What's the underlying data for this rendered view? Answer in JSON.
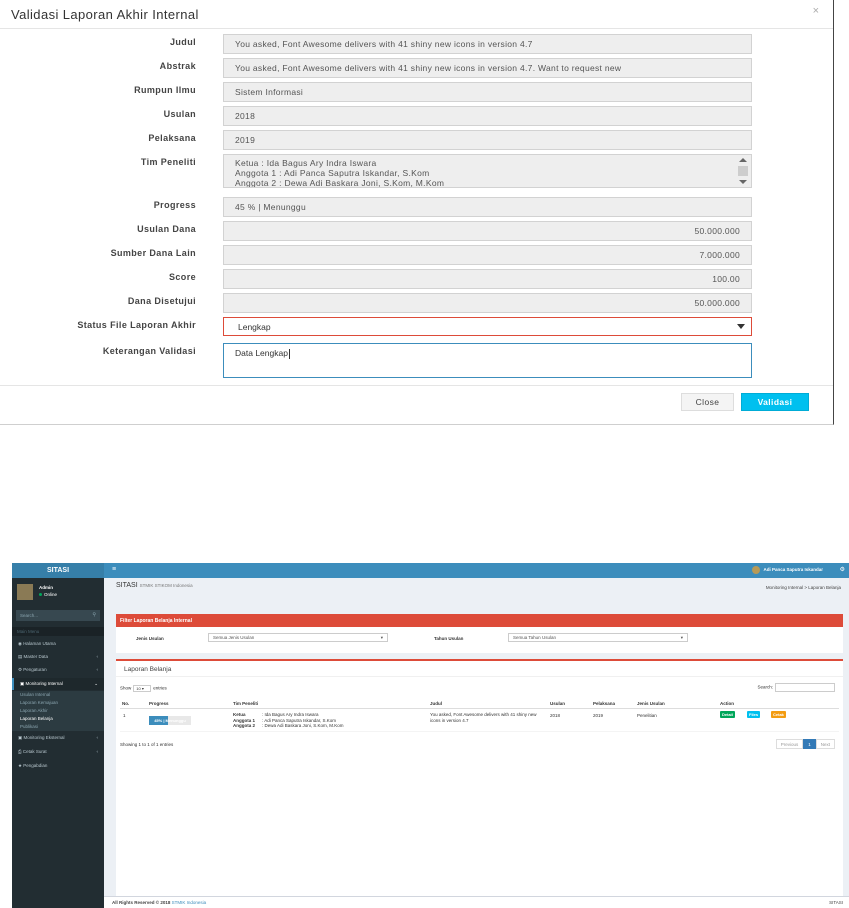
{
  "modal": {
    "title": "Validasi Laporan Akhir Internal",
    "close_glyph": "×",
    "fields": {
      "judul": {
        "label": "Judul",
        "value": "You asked, Font Awesome delivers with 41 shiny new icons in version 4.7"
      },
      "abstrak": {
        "label": "Abstrak",
        "value": "You asked, Font Awesome delivers with 41 shiny new icons in version 4.7. Want to request new"
      },
      "rumpun": {
        "label": "Rumpun Ilmu",
        "value": "Sistem Informasi"
      },
      "usulan": {
        "label": "Usulan",
        "value": "2018"
      },
      "pelaksana": {
        "label": "Pelaksana",
        "value": "2019"
      },
      "tim": {
        "label": "Tim Peneliti",
        "lines": [
          "Ketua : Ida Bagus Ary Indra Iswara",
          "Anggota 1 : Adi Panca Saputra Iskandar, S.Kom",
          "Anggota 2 : Dewa Adi Baskara Joni, S.Kom, M.Kom"
        ]
      },
      "progress": {
        "label": "Progress",
        "value": "45 %  |  Menunggu"
      },
      "usulan_dana": {
        "label": "Usulan Dana",
        "value": "50.000.000"
      },
      "sumber_dana": {
        "label": "Sumber Dana Lain",
        "value": "7.000.000"
      },
      "score": {
        "label": "Score",
        "value": "100.00"
      },
      "dana_disetujui": {
        "label": "Dana Disetujui",
        "value": "50.000.000"
      },
      "status_file": {
        "label": "Status File Laporan Akhir",
        "value": "Lengkap"
      },
      "keterangan": {
        "label": "Keterangan Validasi",
        "value": "Data Lengkap"
      }
    },
    "buttons": {
      "close": "Close",
      "validasi": "Validasi"
    },
    "colors": {
      "validasi_button": "#00c0ef",
      "select_border": "#dd4b39",
      "active_border": "#3c8dbc"
    }
  },
  "app": {
    "logo": "SITASI",
    "topbar_user": "Adi Panca Saputra Iskandar",
    "sidebar": {
      "user_name": "Admin",
      "user_status": "Online",
      "search_placeholder": "Search...",
      "header": "Main Menu",
      "items": [
        {
          "label": "Halaman Utama",
          "icon": "dashboard-icon"
        },
        {
          "label": "Master Data",
          "icon": "database-icon"
        },
        {
          "label": "Pengaturan",
          "icon": "gears-icon"
        },
        {
          "label": "Monitoring Internal",
          "icon": "desktop-icon"
        },
        {
          "label": "Monitoring Eksternal",
          "icon": "desktop-icon"
        },
        {
          "label": "Cetak Surat",
          "icon": "print-icon"
        },
        {
          "label": "Pengabdian",
          "icon": "star-icon"
        }
      ],
      "subitems": [
        "Usulan Internal",
        "Laporan Kemajuan",
        "Laporan Akhir",
        "Laporan Belanja",
        "Publikasi"
      ]
    },
    "page_title": "SITASI",
    "page_subtitle": "STMIK STIKOM Indonesia",
    "breadcrumb": "Monitoring Internal  >  Laporan Belanja",
    "filter": {
      "title": "Filter Laporan Belanja Internal",
      "jenis_label": "Jenis Usulan",
      "jenis_value": "Semua Jenis Usulan",
      "tahun_label": "Tahun Usulan",
      "tahun_value": "Semua Tahun Usulan"
    },
    "table_box": {
      "title": "Laporan Belanja",
      "show": "Show",
      "show_value": "10",
      "entries": "entries",
      "search": "Search:",
      "headers": [
        "No.",
        "Progress",
        "Tim Peneliti",
        "Judul",
        "Usulan",
        "Pelaksana",
        "Jenis Usulan",
        "Action"
      ],
      "row": {
        "no": "1",
        "progress_text": "45% | Menunggu",
        "progress_value": 0.45,
        "tim": [
          "Ketua",
          "Anggota 1",
          "Anggota 2"
        ],
        "tim_names": [
          ": Ida Bagus Ary Indra Iswara",
          ": Adi Panca Saputra Iskandar, S.Kom",
          ": Dewa Adi Baskara Joni, S.Kom, M.Kom"
        ],
        "judul_1": "You asked, Font Awesome delivers with 41 shiny new",
        "judul_2": "icons in version 4.7",
        "usulan": "2018",
        "pelaksana": "2019",
        "jenis": "Penelitian",
        "actions": [
          "Detail",
          "Files",
          "Cetak"
        ]
      },
      "showing": "Showing 1 to 1 of 1 entries",
      "pager": [
        "Previous",
        "1",
        "Next"
      ]
    },
    "footer": {
      "copyright": "All Rights Reserved © 2018",
      "link": "STMIK Indonesia",
      "right": "SITASI"
    }
  }
}
